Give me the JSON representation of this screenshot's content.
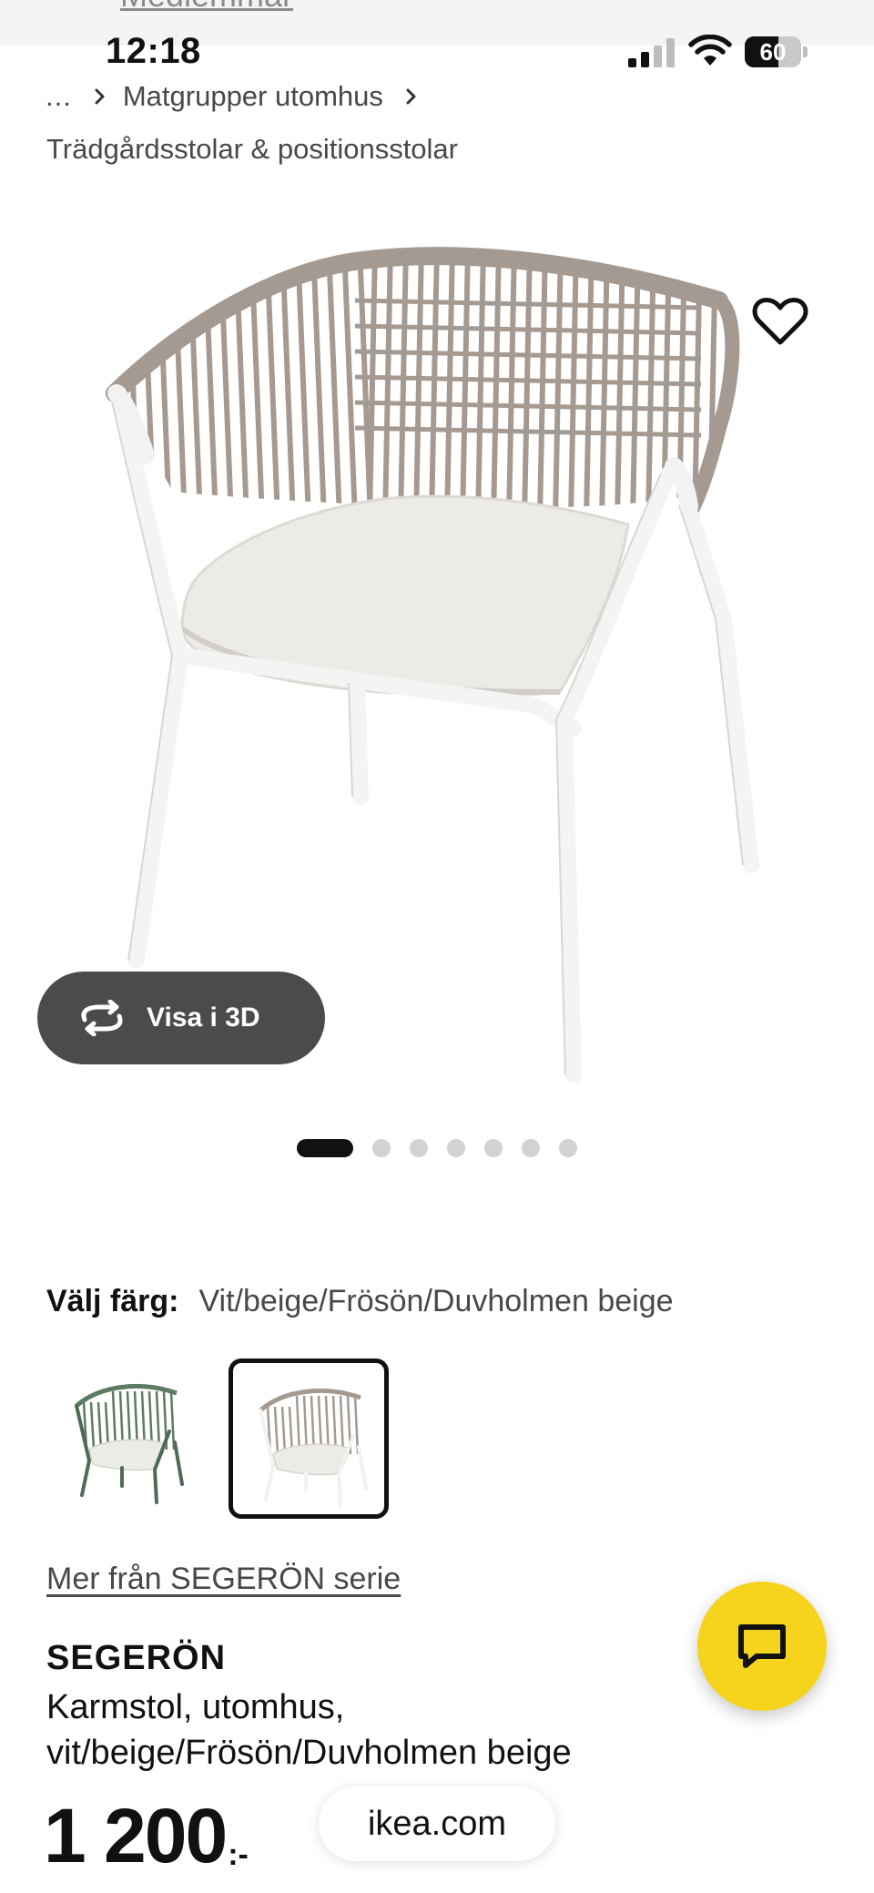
{
  "header": {
    "partial_link": "Medlemmar"
  },
  "status_bar": {
    "time": "12:18",
    "battery": "60",
    "battery_level_percent": 60
  },
  "breadcrumb": {
    "ellipsis": "...",
    "items": [
      "Matgrupper utomhus",
      "Trädgårdsstolar & positionsstolar"
    ]
  },
  "gallery": {
    "view_3d_label": "Visa i 3D",
    "image_count": 7,
    "active_index": 0
  },
  "color_picker": {
    "label": "Välj färg:",
    "selected": "Vit/beige/Frösön/Duvholmen beige",
    "options": [
      {
        "frame": "#4f6b55",
        "rope": "#5d7a62",
        "cushion": "#ecebe6",
        "selected": false
      },
      {
        "frame": "#f2f2f2",
        "rope": "#a49a91",
        "cushion": "#ecebe6",
        "selected": true
      }
    ]
  },
  "series_link": "Mer från SEGERÖN serie",
  "product": {
    "name": "SEGERÖN",
    "description": "Karmstol, utomhus, vit/beige/Frösön/Duvholmen beige",
    "price_integer": "1 200",
    "price_suffix": ":-"
  },
  "browser": {
    "url": "ikea.com"
  },
  "colors": {
    "chat_button": "#f6d31c",
    "visa3d_button": "#4b4b4b",
    "active_dot": "#111111",
    "inactive_dot": "#d2d2d2"
  },
  "icons": {
    "favourite": "heart-icon",
    "rotate_3d": "rotate-icon",
    "chat": "chat-icon",
    "chevron": "chevron-right-icon"
  }
}
